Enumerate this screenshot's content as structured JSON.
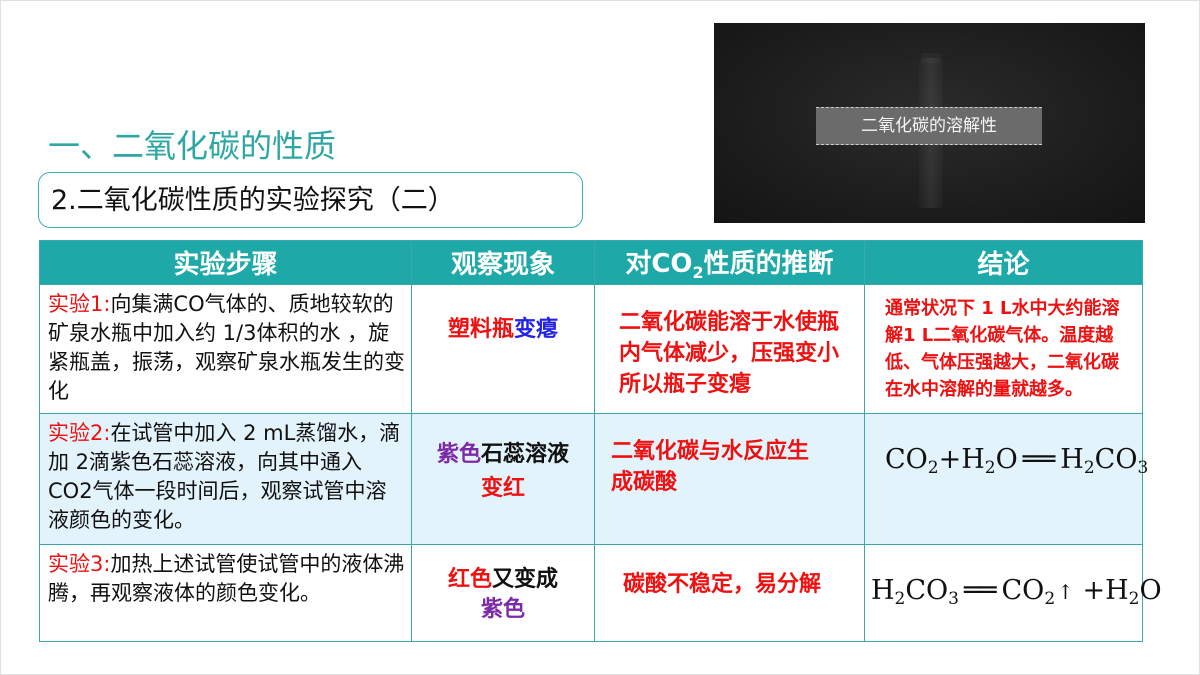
{
  "section_title": "一、二氧化碳的性质",
  "subtitle": "2.二氧化碳性质的实验探究（二）",
  "video": {
    "caption": "二氧化碳的溶解性"
  },
  "table": {
    "headers": {
      "h1": "实验步骤",
      "h2": "观察现象",
      "h3_prefix": "对CO",
      "h3_sub": "2",
      "h3_suffix": "性质的推断",
      "h4": "结论"
    },
    "rows": [
      {
        "step_label": "实验1:",
        "step_text": "向集满CO气体的、质地较软的矿泉水瓶中加入约 1/3体积的水 ，旋紧瓶盖，振荡，观察矿泉水瓶发生的变化",
        "obs_part1": "塑料瓶",
        "obs_part2": "变瘪",
        "inference": "二氧化碳能溶于水使瓶内气体减少，压强变小所以瓶子变瘪",
        "conclusion": "通常状况下 1 L水中大约能溶解1 L二氧化碳气体。温度越低、气体压强越大，二氧化碳在水中溶解的量就越多。"
      },
      {
        "step_label": "实验2:",
        "step_text": "在试管中加入 2 mL蒸馏水，滴加 2滴紫色石蕊溶液，向其中通入 CO2气体一段时间后，观察试管中溶液颜色的变化。",
        "obs_part1": "紫色",
        "obs_part2": "石蕊溶液",
        "obs_line2": "变红",
        "inference": "二氧化碳与水反应生成碳酸",
        "eq": {
          "a": "CO",
          "a_sub": "2",
          "plus1": "+H",
          "b_sub": "2",
          "b_rest": "O",
          "eqsign": "══",
          "c": "H",
          "c_sub": "2",
          "c_mid": "CO",
          "c_sub2": "3"
        }
      },
      {
        "step_label": "实验3:",
        "step_text": "加热上述试管使试管中的液体沸腾，再观察液体的颜色变化。",
        "obs_part1": "红色",
        "obs_part2": "又变成",
        "obs_line2": "紫色",
        "inference": "碳酸不稳定，易分解",
        "eq": {
          "a": "H",
          "a_sub": "2",
          "a_mid": "CO",
          "a_sub2": "3",
          "eqsign": "══",
          "b": "CO",
          "b_sub": "2",
          "arrow": "↑",
          "plus": " +H",
          "c_sub": "2",
          "c_rest": "O"
        }
      }
    ]
  },
  "colors": {
    "teal": "#1ea9a8",
    "title_teal": "#2ea7a4",
    "red": "#ee1111",
    "purple": "#7d2aa8",
    "blue": "#2323e8"
  }
}
